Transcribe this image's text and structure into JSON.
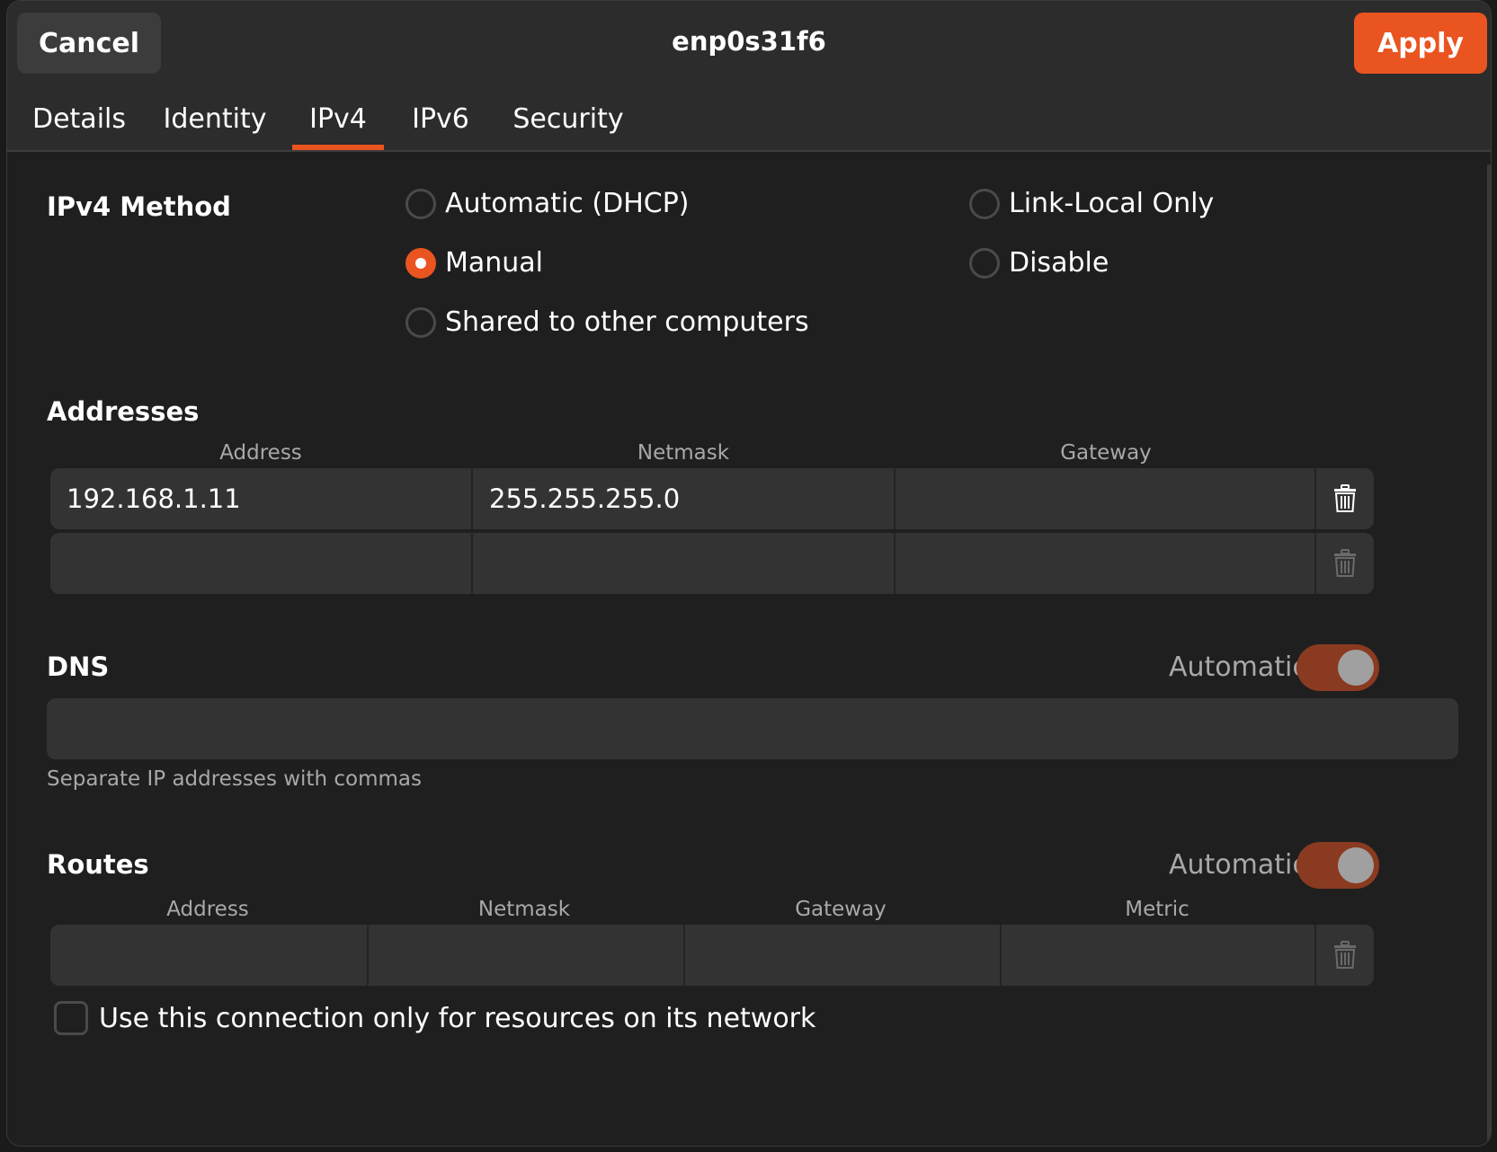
{
  "header": {
    "cancel_label": "Cancel",
    "title": "enp0s31f6",
    "apply_label": "Apply"
  },
  "tabs": [
    {
      "label": "Details"
    },
    {
      "label": "Identity"
    },
    {
      "label": "IPv4",
      "active": true
    },
    {
      "label": "IPv6"
    },
    {
      "label": "Security"
    }
  ],
  "ipv4_method": {
    "title": "IPv4 Method",
    "options": [
      {
        "label": "Automatic (DHCP)",
        "checked": false
      },
      {
        "label": "Manual",
        "checked": true
      },
      {
        "label": "Shared to other computers",
        "checked": false
      },
      {
        "label": "Link-Local Only",
        "checked": false
      },
      {
        "label": "Disable",
        "checked": false
      }
    ]
  },
  "addresses": {
    "title": "Addresses",
    "columns": [
      "Address",
      "Netmask",
      "Gateway"
    ],
    "rows": [
      {
        "address": "192.168.1.11",
        "netmask": "255.255.255.0",
        "gateway": ""
      },
      {
        "address": "",
        "netmask": "",
        "gateway": ""
      }
    ]
  },
  "dns": {
    "title": "DNS",
    "automatic_label": "Automatic",
    "automatic_on": true,
    "value": "",
    "hint": "Separate IP addresses with commas"
  },
  "routes": {
    "title": "Routes",
    "automatic_label": "Automatic",
    "automatic_on": true,
    "columns": [
      "Address",
      "Netmask",
      "Gateway",
      "Metric"
    ],
    "rows": [
      {
        "address": "",
        "netmask": "",
        "gateway": "",
        "metric": ""
      }
    ]
  },
  "local_only": {
    "label": "Use this connection only for resources on its network",
    "checked": false
  },
  "colors": {
    "accent": "#e95420",
    "switch_track": "#8a3a20",
    "background": "#242424",
    "entry": "#333333"
  },
  "icons": [
    "trash-icon"
  ]
}
